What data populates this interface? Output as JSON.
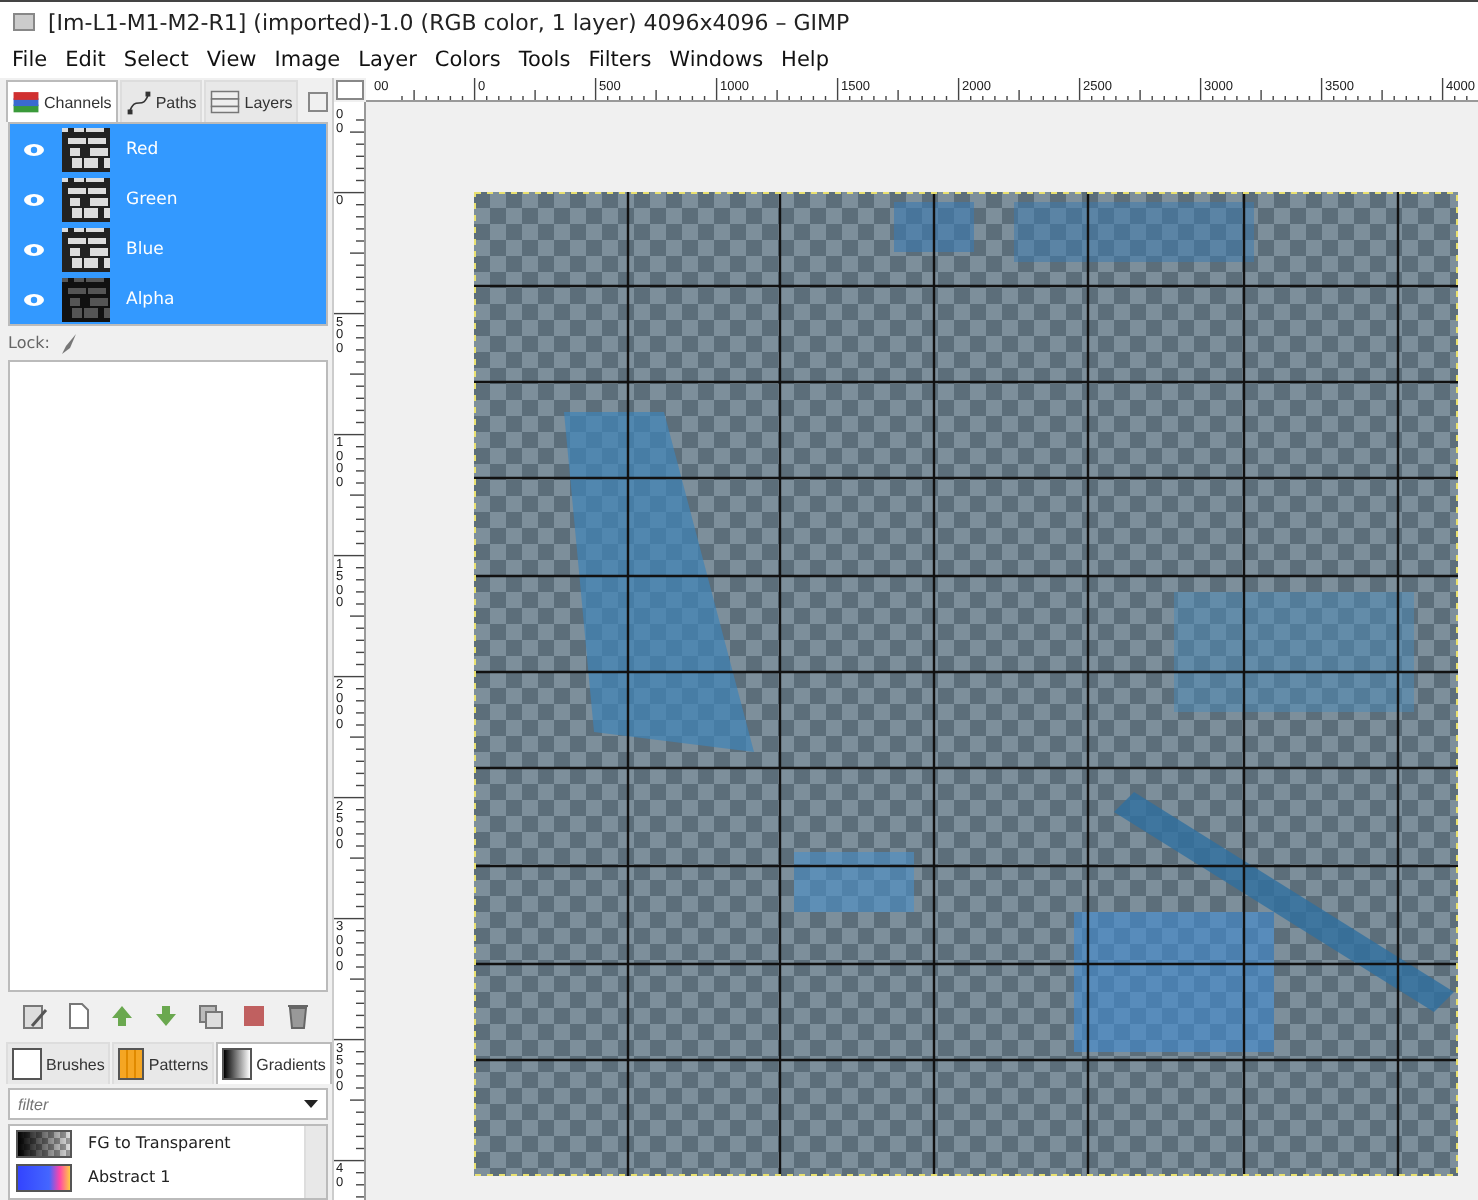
{
  "window": {
    "title": "[Im-L1-M1-M2-R1] (imported)-1.0 (RGB color, 1 layer) 4096x4096 – GIMP"
  },
  "menu": [
    "File",
    "Edit",
    "Select",
    "View",
    "Image",
    "Layer",
    "Colors",
    "Tools",
    "Filters",
    "Windows",
    "Help"
  ],
  "top_dock": {
    "tabs": [
      {
        "label": "Channels",
        "kind": "channels",
        "selected": true
      },
      {
        "label": "Paths",
        "kind": "paths",
        "selected": false
      },
      {
        "label": "Layers",
        "kind": "layers",
        "selected": false
      }
    ],
    "channels": [
      {
        "name": "Red",
        "visible": true,
        "selected": true
      },
      {
        "name": "Green",
        "visible": true,
        "selected": true
      },
      {
        "name": "Blue",
        "visible": true,
        "selected": true
      },
      {
        "name": "Alpha",
        "visible": true,
        "selected": true
      }
    ],
    "lock_label": "Lock:"
  },
  "bottom_dock": {
    "tabs": [
      {
        "label": "Brushes",
        "kind": "brushes",
        "selected": false
      },
      {
        "label": "Patterns",
        "kind": "patterns",
        "selected": false
      },
      {
        "label": "Gradients",
        "kind": "gradients",
        "selected": true
      }
    ],
    "filter": {
      "placeholder": "filter"
    },
    "gradients": [
      {
        "name": "FG to Transparent",
        "kind": "fg-transparent"
      },
      {
        "name": "Abstract 1",
        "kind": "abstract"
      }
    ]
  },
  "rulers": {
    "horizontal": [
      "00",
      "0",
      "500",
      "1000",
      "1500",
      "2000",
      "2500",
      "3000",
      "3500",
      "4000"
    ],
    "vertical": [
      "00",
      "0",
      "500",
      "1000",
      "1500",
      "2000",
      "2500",
      "3000",
      "3500",
      "40"
    ]
  }
}
